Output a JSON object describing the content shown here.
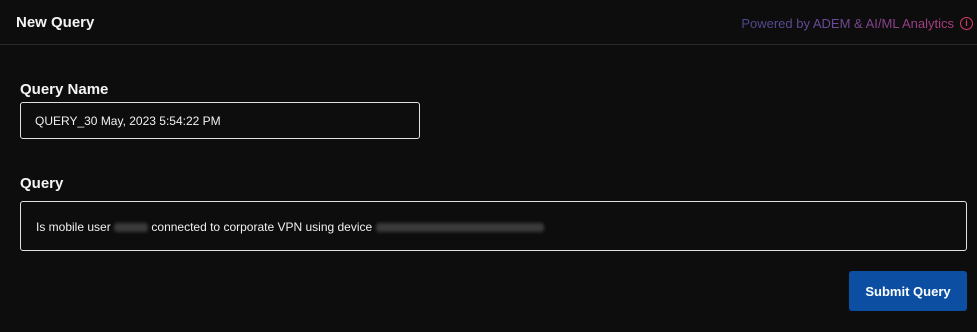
{
  "header": {
    "title": "New Query",
    "powered_by": "Powered by ADEM & AI/ML Analytics",
    "info_glyph": "i"
  },
  "form": {
    "query_name_label": "Query Name",
    "query_name_value": "QUERY_30 May, 2023 5:54:22 PM",
    "query_label": "Query",
    "query_text_part1": "Is  mobile user",
    "query_text_part2": "connected to corporate VPN using device"
  },
  "actions": {
    "submit_label": "Submit Query"
  },
  "colors": {
    "background": "#0d0d0d",
    "accent": "#0b4ea2",
    "info_icon": "#d63c6a"
  }
}
